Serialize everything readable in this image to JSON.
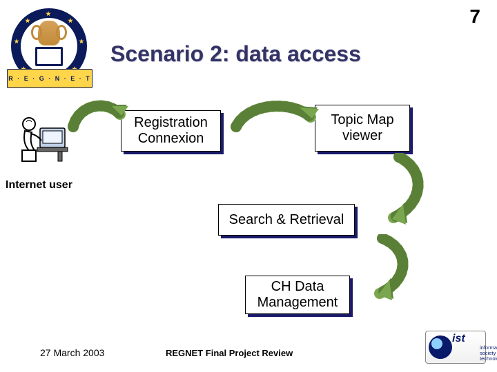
{
  "page_number": "7",
  "title": "Scenario 2: data access",
  "user_label": "Internet user",
  "nodes": {
    "registration": {
      "line1": "Registration",
      "line2": "Connexion"
    },
    "topic_map": {
      "line1": "Topic Map",
      "line2": "viewer"
    },
    "search": {
      "line1": "Search & Retrieval"
    },
    "ch_data": {
      "line1": "CH Data",
      "line2": "Management"
    }
  },
  "footer": {
    "date": "27 March 2003",
    "center": "REGNET Final Project Review"
  },
  "logos": {
    "main_banner": "R · E · G · N · E · T",
    "ist_big": "ist",
    "ist_small": "information society technologies"
  },
  "colors": {
    "title": "#333366",
    "arrow": "#7aa64f",
    "shadow": "#1a1a6a"
  }
}
